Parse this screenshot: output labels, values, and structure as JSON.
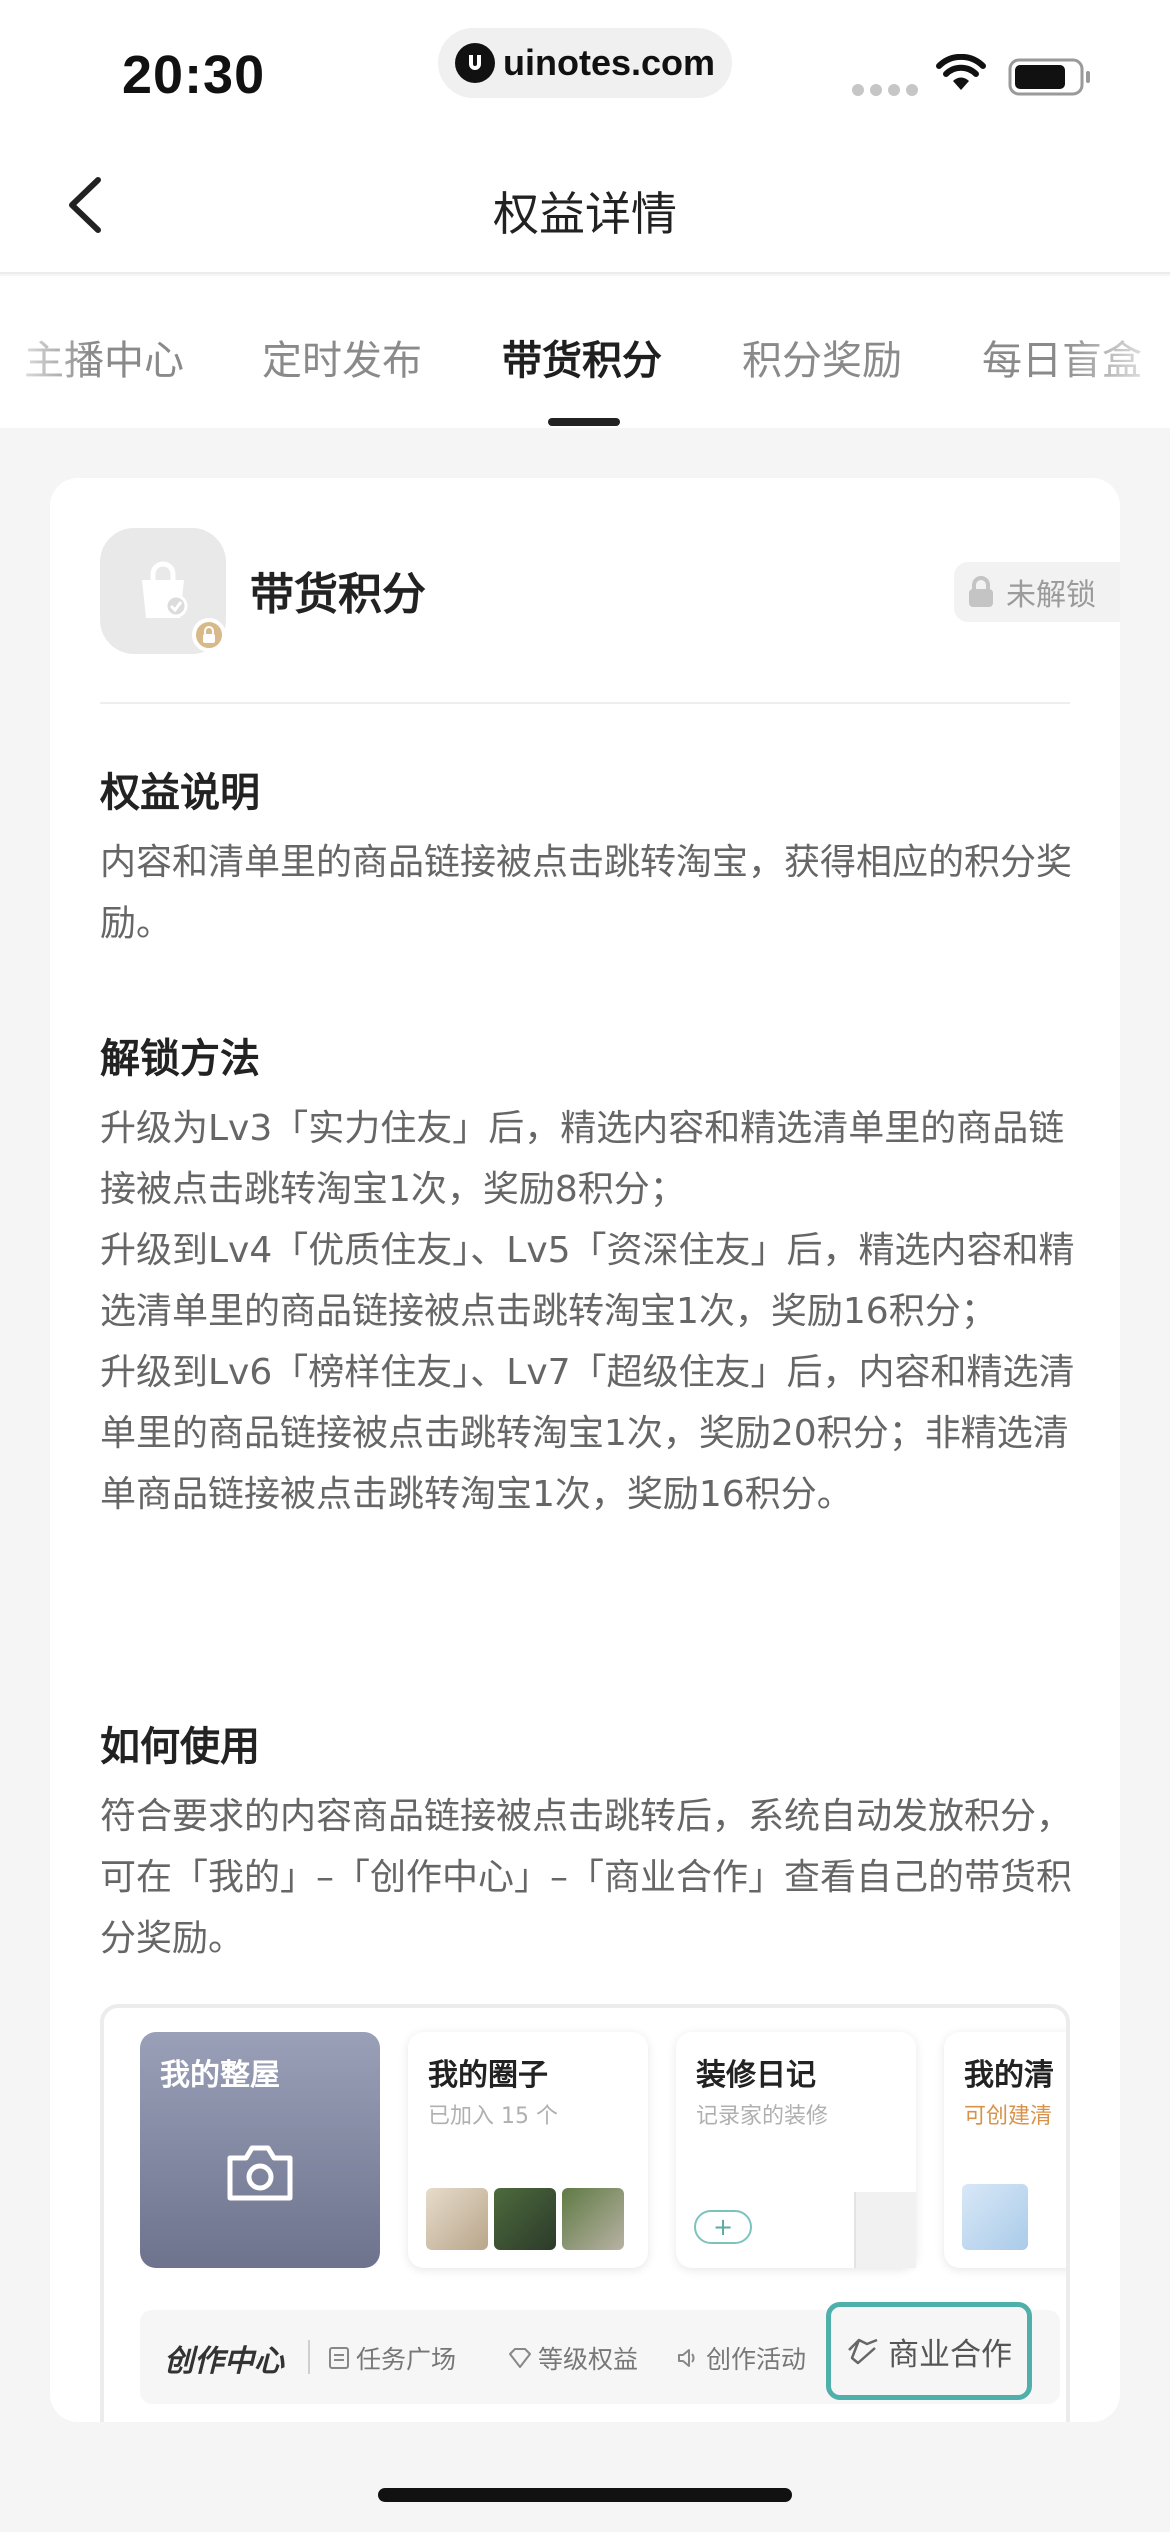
{
  "status_bar": {
    "time": "20:30",
    "url": "uinotes.com",
    "icons": [
      "signal-dots-icon",
      "wifi-icon",
      "battery-icon"
    ]
  },
  "nav": {
    "title": "权益详情",
    "back_icon": "chevron-left-icon"
  },
  "tabs": [
    {
      "label": "主播中心",
      "active": false
    },
    {
      "label": "定时发布",
      "active": false
    },
    {
      "label": "带货积分",
      "active": true
    },
    {
      "label": "积分奖励",
      "active": false
    },
    {
      "label": "每日盲盒",
      "active": false
    }
  ],
  "benefit": {
    "name": "带货积分",
    "status": "未解锁",
    "icon": "shopping-bag-icon"
  },
  "sections": {
    "description": {
      "title": "权益说明",
      "body": "内容和清单里的商品链接被点击跳转淘宝，获得相应的积分奖励。"
    },
    "unlock": {
      "title": "解锁方法",
      "lines": [
        "升级为Lv3「实力住友」后，精选内容和精选清单里的商品链接被点击跳转淘宝1次，奖励8积分；",
        "升级到Lv4「优质住友」、Lv5「资深住友」后，精选内容和精选清单里的商品链接被点击跳转淘宝1次，奖励16积分；",
        "升级到Lv6「榜样住友」、Lv7「超级住友」后，内容和精选清单里的商品链接被点击跳转淘宝1次，奖励20积分；非精选清单商品链接被点击跳转淘宝1次，奖励16积分。"
      ]
    },
    "usage": {
      "title": "如何使用",
      "body": "符合要求的内容商品链接被点击跳转后，系统自动发放积分，可在「我的」–「创作中心」–「商业合作」查看自己的带货积分奖励。"
    }
  },
  "preview": {
    "cards": [
      {
        "title": "我的整屋",
        "subtitle": ""
      },
      {
        "title": "我的圈子",
        "subtitle": "已加入 15 个"
      },
      {
        "title": "装修日记",
        "subtitle": "记录家的装修"
      },
      {
        "title": "我的清",
        "subtitle": "可创建清"
      }
    ],
    "plus_label": "+",
    "creator_logo": "创作中心",
    "creator_items": [
      "任务广场",
      "等级权益",
      "创作活动"
    ],
    "business_item": "商业合作",
    "colors": {
      "highlight": "#4fb0ab",
      "dark_card": "#7d829b"
    }
  }
}
